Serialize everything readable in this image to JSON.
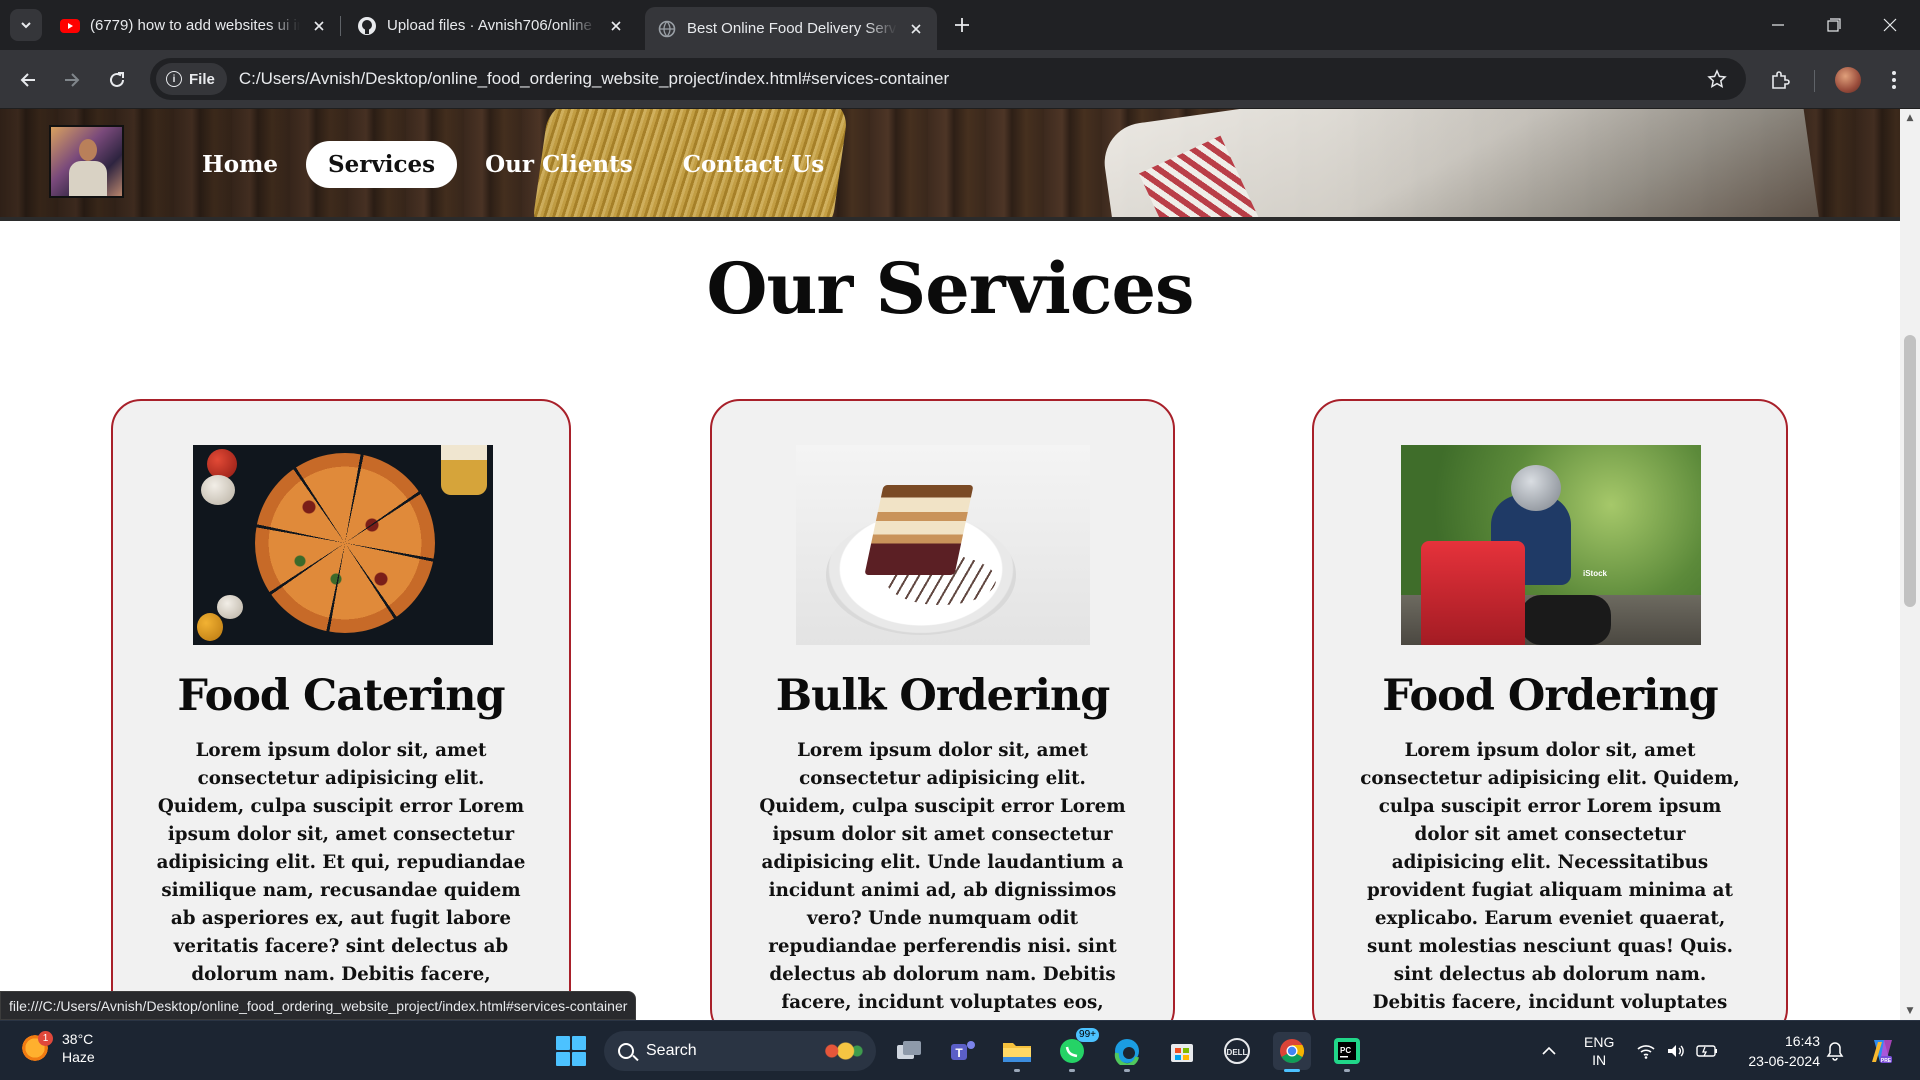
{
  "browser": {
    "tabs": [
      {
        "title": "(6779) how to add websites ui in",
        "icon": "youtube-icon"
      },
      {
        "title": "Upload files · Avnish706/online",
        "icon": "github-icon"
      },
      {
        "title": "Best Online Food Delivery Servi",
        "icon": "globe-icon",
        "active": true
      }
    ],
    "file_chip": "File",
    "url": "C:/Users/Avnish/Desktop/online_food_ordering_website_project/index.html#services-container",
    "status_url": "file:///C:/Users/Avnish/Desktop/online_food_ordering_website_project/index.html#services-container"
  },
  "page": {
    "nav": [
      "Home",
      "Services",
      "Our Clients",
      "Contact Us"
    ],
    "active_nav": "Services",
    "section_title": "Our Services",
    "cards": [
      {
        "title": "Food Catering",
        "image": "pizza-image",
        "text": "Lorem ipsum dolor sit, amet consectetur adipisicing elit. Quidem, culpa suscipit error Lorem ipsum dolor sit, amet consectetur adipisicing elit. Et qui, repudiandae similique nam, recusandae quidem ab asperiores ex, aut fugit labore veritatis facere? sint delectus ab dolorum nam. Debitis facere, incidunt voluptates eos, mollitia voluptatem iste sunt"
      },
      {
        "title": "Bulk Ordering",
        "image": "cake-image",
        "text": "Lorem ipsum dolor sit, amet consectetur adipisicing elit. Quidem, culpa suscipit error Lorem ipsum dolor sit amet consectetur adipisicing elit. Unde laudantium a incidunt animi ad, ab dignissimos vero? Unde numquam odit repudiandae perferendis nisi. sint delectus ab dolorum nam. Debitis facere, incidunt voluptates eos, mollitia voluptatem iste sunt voluptas beatae"
      },
      {
        "title": "Food Ordering",
        "image": "delivery-rider-image",
        "image_watermark": "iStock",
        "text": "Lorem ipsum dolor sit, amet consectetur adipisicing elit. Quidem, culpa suscipit error Lorem ipsum dolor sit amet consectetur adipisicing elit. Necessitatibus provident fugiat aliquam minima at explicabo. Earum eveniet quaerat, sunt molestias nesciunt quas! Quis. sint delectus ab dolorum nam. Debitis facere, incidunt voluptates eos, mollitia voluptatem iste sunt voluptas beatae facilis labore, omnis"
      }
    ],
    "colors": {
      "card_border": "#a8202a",
      "card_bg": "#f1f1f1"
    }
  },
  "taskbar": {
    "weather": {
      "temp": "38°C",
      "condition": "Haze",
      "badge": "1"
    },
    "search_placeholder": "Search",
    "whatsapp_badge": "99+",
    "lang": {
      "line1": "ENG",
      "line2": "IN"
    },
    "time": "16:43",
    "date": "23-06-2024"
  }
}
